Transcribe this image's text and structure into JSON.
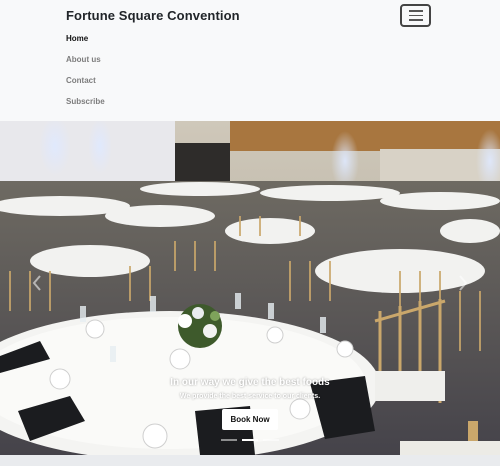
{
  "navbar": {
    "brand": "Fortune Square Convention",
    "toggler_icon": "hamburger-icon",
    "links": [
      {
        "label": "Home",
        "active": true
      },
      {
        "label": "About us",
        "active": false
      },
      {
        "label": "Contact",
        "active": false
      },
      {
        "label": "Subscribe",
        "active": false
      }
    ]
  },
  "carousel": {
    "image": "banquet-hall-photo",
    "caption_title": "In our way we give the best foods",
    "caption_text": "We provide the best service to our clients.",
    "button_label": "Book Now",
    "slides": 3,
    "active_slide": 1,
    "prev_icon": "chevron-left-icon",
    "next_icon": "chevron-right-icon"
  },
  "colors": {
    "navbar_bg": "#f8f9fa",
    "active_link": "#111111",
    "inactive_link": "#7d7d7d",
    "button_bg": "#ffffff"
  }
}
